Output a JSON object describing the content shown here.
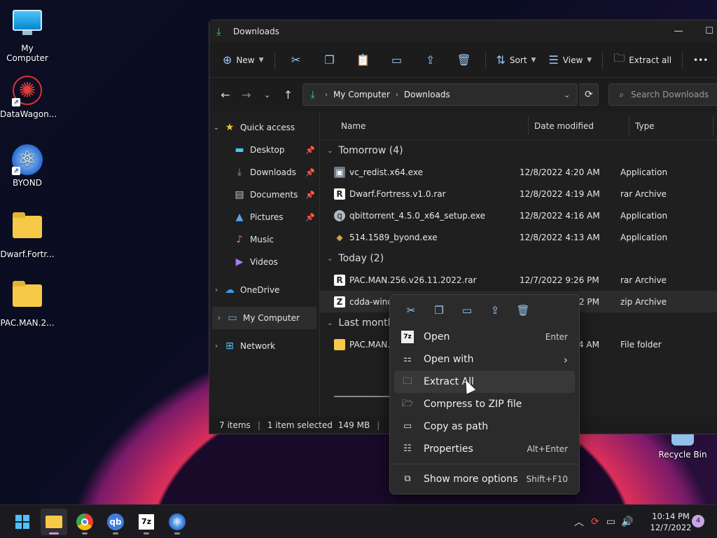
{
  "desktop": {
    "icons": [
      {
        "label": "My Computer"
      },
      {
        "label": "DataWagon..."
      },
      {
        "label": "BYOND"
      },
      {
        "label": "Dwarf.Fortr..."
      },
      {
        "label": "PAC.MAN.2..."
      }
    ],
    "recycle_bin": "Recycle Bin"
  },
  "window": {
    "title": "Downloads",
    "toolbar": {
      "new_label": "New",
      "sort_label": "Sort",
      "view_label": "View",
      "extract_all_label": "Extract all",
      "more_label": "•••"
    },
    "address": {
      "segment_1": "My Computer",
      "segment_2": "Downloads",
      "search_placeholder": "Search Downloads"
    },
    "nav": {
      "quick_access": "Quick access",
      "items": [
        "Desktop",
        "Downloads",
        "Documents",
        "Pictures",
        "Music",
        "Videos"
      ],
      "onedrive": "OneDrive",
      "my_computer": "My Computer",
      "network": "Network"
    },
    "columns": {
      "name": "Name",
      "date": "Date modified",
      "type": "Type"
    },
    "groups": {
      "tomorrow": "Tomorrow (4)",
      "today": "Today (2)",
      "last_month": "Last month"
    },
    "files": {
      "tomorrow": [
        {
          "name": "vc_redist.x64.exe",
          "date": "12/8/2022 4:20 AM",
          "type": "Application"
        },
        {
          "name": "Dwarf.Fortress.v1.0.rar",
          "date": "12/8/2022 4:19 AM",
          "type": "rar Archive"
        },
        {
          "name": "qbittorrent_4.5.0_x64_setup.exe",
          "date": "12/8/2022 4:16 AM",
          "type": "Application"
        },
        {
          "name": "514.1589_byond.exe",
          "date": "12/8/2022 4:13 AM",
          "type": "Application"
        }
      ],
      "today": [
        {
          "name": "PAC.MAN.256.v26.11.2022.rar",
          "date": "12/7/2022 9:26 PM",
          "type": "rar Archive"
        },
        {
          "name": "cdda-windo",
          "date": ":12 PM",
          "type": "zip Archive"
        }
      ],
      "last_month": [
        {
          "name": "PAC.MAN.2",
          "date": ":24 AM",
          "type": "File folder"
        }
      ]
    },
    "status": {
      "items": "7 items",
      "selected": "1 item selected",
      "size": "149 MB"
    }
  },
  "context_menu": {
    "items": [
      {
        "label": "Open",
        "shortcut": "Enter"
      },
      {
        "label": "Open with",
        "shortcut": "›"
      },
      {
        "label": "Extract All",
        "shortcut": ""
      },
      {
        "label": "Compress to ZIP file",
        "shortcut": ""
      },
      {
        "label": "Copy as path",
        "shortcut": ""
      },
      {
        "label": "Properties",
        "shortcut": "Alt+Enter"
      },
      {
        "label": "Show more options",
        "shortcut": "Shift+F10"
      }
    ]
  },
  "taskbar": {
    "time": "10:14 PM",
    "date": "12/7/2022",
    "notification_count": "4"
  }
}
